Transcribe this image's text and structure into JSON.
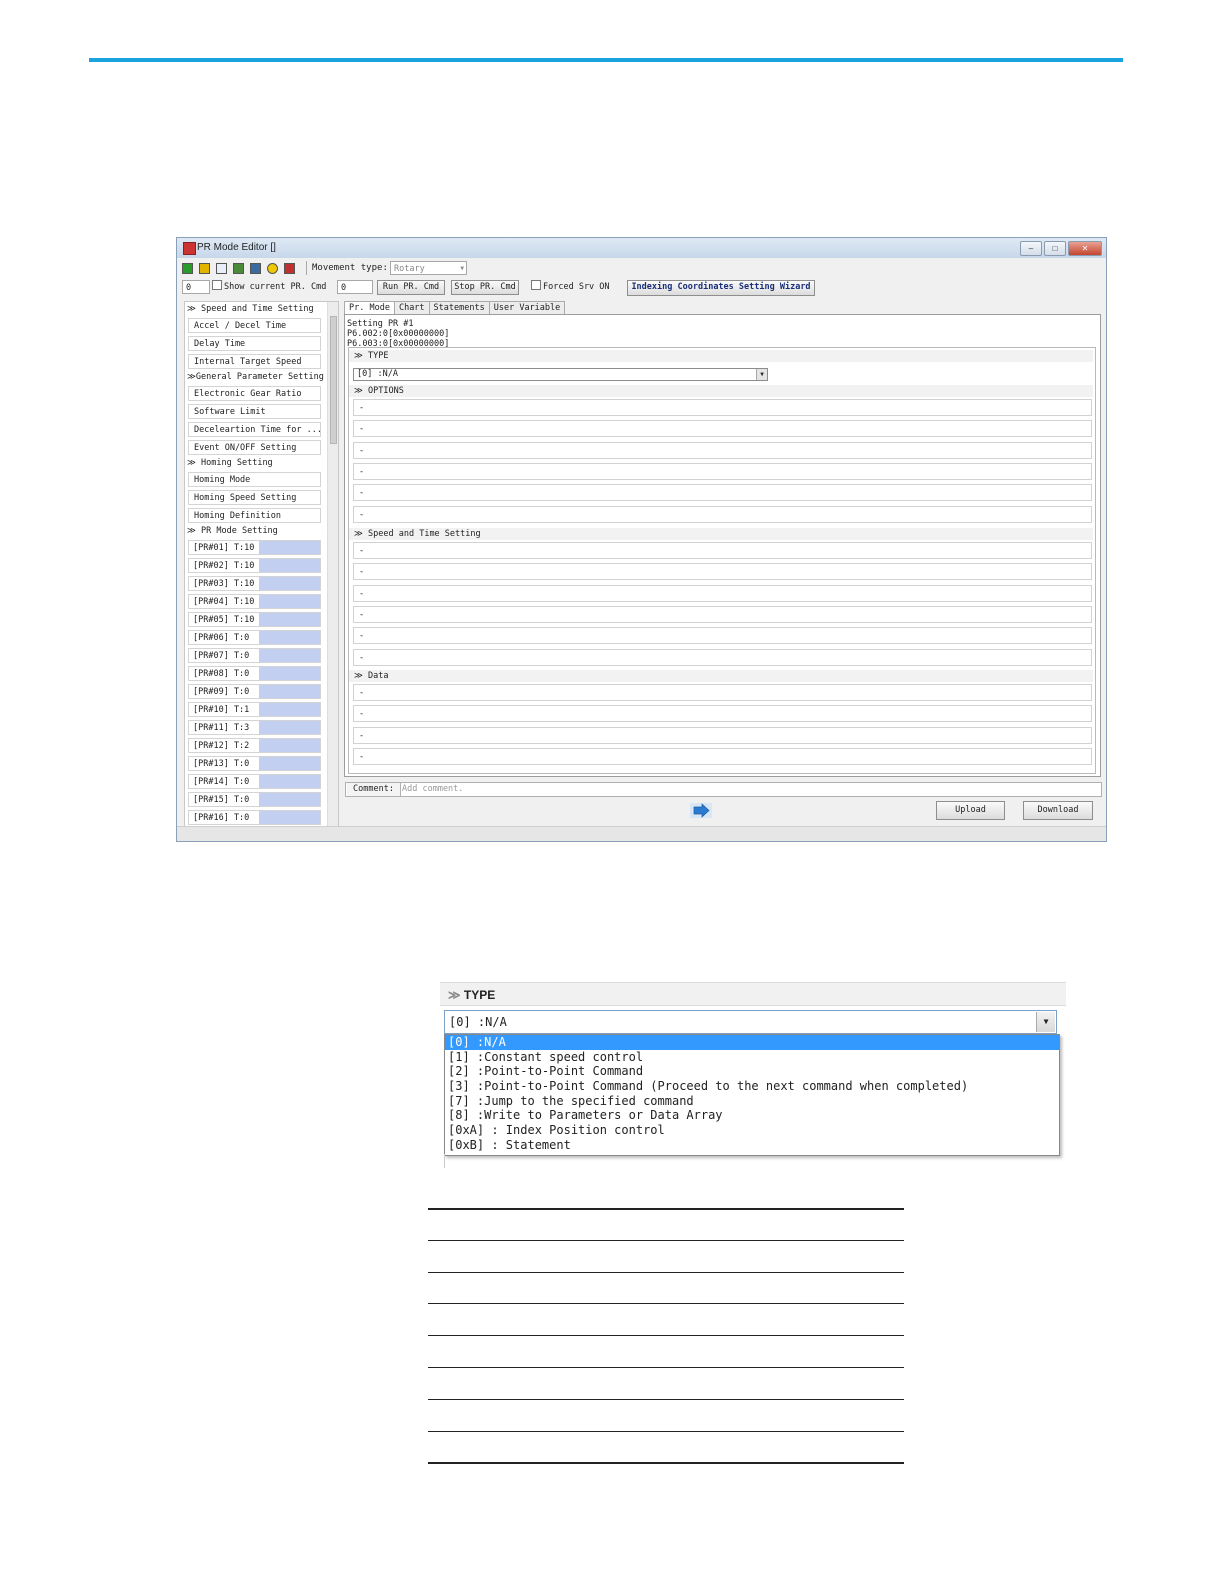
{
  "window": {
    "title": "PR Mode Editor []",
    "controls": {
      "minimize": "‒",
      "maximize": "□",
      "close": "✕"
    }
  },
  "toolbar": {
    "movement_type_label": "Movement type:",
    "movement_type_value": "Rotary",
    "pr_index": "0",
    "show_current_label": "Show current PR. Cmd",
    "cmd_value": "0",
    "run_label": "Run PR. Cmd",
    "stop_label": "Stop PR. Cmd",
    "forced_label": "Forced Srv ON",
    "wizard_label": "Indexing Coordinates Setting Wizard"
  },
  "sidebar": {
    "groups": [
      {
        "label": "Speed and Time Setting",
        "items": [
          "Accel / Decel Time",
          "Delay Time",
          "Internal Target Speed"
        ]
      },
      {
        "label": "General Parameter Setting",
        "items": [
          "Electronic Gear Ratio",
          "Software Limit",
          "Deceleartion Time for ...",
          "Event ON/OFF Setting"
        ]
      },
      {
        "label": "Homing Setting",
        "items": [
          "Homing Mode",
          "Homing Speed Setting",
          "Homing Definition"
        ]
      },
      {
        "label": "PR Mode Setting",
        "items": []
      }
    ],
    "pr_items": [
      "[PR#01] T:10",
      "[PR#02] T:10",
      "[PR#03] T:10",
      "[PR#04] T:10",
      "[PR#05] T:10",
      "[PR#06] T:0",
      "[PR#07] T:0",
      "[PR#08] T:0",
      "[PR#09] T:0",
      "[PR#10] T:1",
      "[PR#11] T:3",
      "[PR#12] T:2",
      "[PR#13] T:0",
      "[PR#14] T:0",
      "[PR#15] T:0",
      "[PR#16] T:0"
    ]
  },
  "tabs": [
    "Pr. Mode",
    "Chart",
    "Statements",
    "User Variable"
  ],
  "panel": {
    "setting_title": "Setting PR #1",
    "p6_002": "P6.002:0[0x00000000]",
    "p6_003": "P6.003:0[0x00000000]",
    "type_header": "TYPE",
    "type_value": "[0] :N/A",
    "options_header": "OPTIONS",
    "speed_header": "Speed and Time Setting",
    "data_header": "Data",
    "empty_value": "-"
  },
  "comment": {
    "label": "Comment:",
    "placeholder": "Add comment."
  },
  "buttons": {
    "upload": "Upload",
    "download": "Download"
  },
  "zoom": {
    "header": "TYPE",
    "selected": "[0] :N/A",
    "options": [
      "[0] :N/A",
      "[1] :Constant speed control",
      "[2] :Point-to-Point Command",
      "[3] :Point-to-Point Command (Proceed to the next command when completed)",
      "[7] :Jump to the specified command",
      "[8] :Write to Parameters or Data Array",
      "[0xA] : Index Position control",
      "[0xB] : Statement"
    ]
  },
  "colors": {
    "accent_line": "#1aa3dd",
    "highlight": "#3399ff",
    "pr_bar": "#c3cff0"
  }
}
